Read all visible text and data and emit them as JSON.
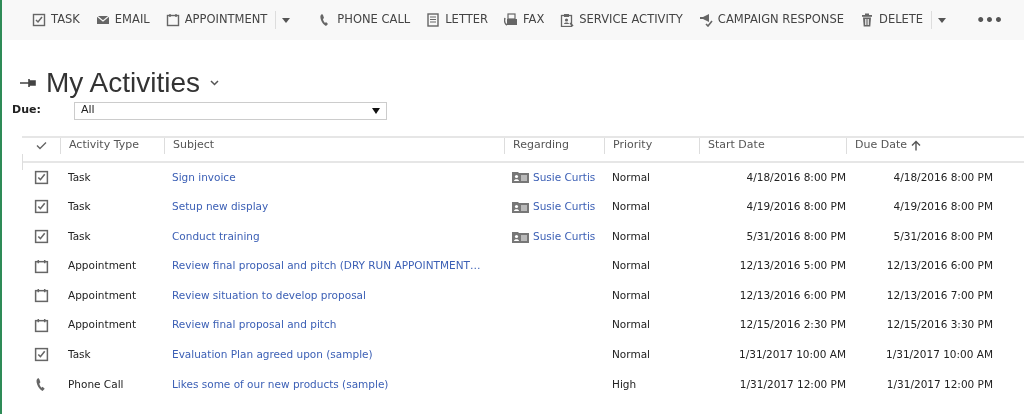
{
  "toolbar": {
    "items": [
      {
        "label": "TASK",
        "kind": "task",
        "split": false
      },
      {
        "label": "EMAIL",
        "kind": "email",
        "split": false
      },
      {
        "label": "APPOINTMENT",
        "kind": "appointment",
        "split": true
      },
      {
        "label": "PHONE CALL",
        "kind": "phone",
        "split": false
      },
      {
        "label": "LETTER",
        "kind": "letter",
        "split": false
      },
      {
        "label": "FAX",
        "kind": "fax",
        "split": false
      },
      {
        "label": "SERVICE ACTIVITY",
        "kind": "service",
        "split": false
      },
      {
        "label": "CAMPAIGN RESPONSE",
        "kind": "campaign",
        "split": false
      },
      {
        "label": "DELETE",
        "kind": "delete",
        "split": true
      }
    ],
    "more": "•••"
  },
  "view": {
    "title": "My Activities"
  },
  "filter": {
    "label": "Due:",
    "value": "All"
  },
  "table": {
    "columns": [
      {
        "label": "Activity Type",
        "sorted": false
      },
      {
        "label": "Subject",
        "sorted": false
      },
      {
        "label": "Regarding",
        "sorted": false
      },
      {
        "label": "Priority",
        "sorted": false
      },
      {
        "label": "Start Date",
        "sorted": false
      },
      {
        "label": "Due Date",
        "sorted": true
      }
    ],
    "rows": [
      {
        "kind": "task",
        "type": "Task",
        "subject": "Sign invoice",
        "regarding": "Susie Curtis",
        "priority": "Normal",
        "start": "4/18/2016 8:00 PM",
        "due": "4/18/2016 8:00 PM"
      },
      {
        "kind": "task",
        "type": "Task",
        "subject": "Setup new display",
        "regarding": "Susie Curtis",
        "priority": "Normal",
        "start": "4/19/2016 8:00 PM",
        "due": "4/19/2016 8:00 PM"
      },
      {
        "kind": "task",
        "type": "Task",
        "subject": "Conduct training",
        "regarding": "Susie Curtis",
        "priority": "Normal",
        "start": "5/31/2016 8:00 PM",
        "due": "5/31/2016 8:00 PM"
      },
      {
        "kind": "appointment",
        "type": "Appointment",
        "subject": "Review final proposal and pitch (DRY RUN APPOINTMENT…",
        "priority": "Normal",
        "start": "12/13/2016 5:00 PM",
        "due": "12/13/2016 6:00 PM"
      },
      {
        "kind": "appointment",
        "type": "Appointment",
        "subject": "Review situation to develop proposal",
        "priority": "Normal",
        "start": "12/13/2016 6:00 PM",
        "due": "12/13/2016 7:00 PM"
      },
      {
        "kind": "appointment",
        "type": "Appointment",
        "subject": "Review final proposal and pitch",
        "priority": "Normal",
        "start": "12/15/2016 2:30 PM",
        "due": "12/15/2016 3:30 PM"
      },
      {
        "kind": "task",
        "type": "Task",
        "subject": "Evaluation Plan agreed upon (sample)",
        "priority": "Normal",
        "start": "1/31/2017 10:00 AM",
        "due": "1/31/2017 10:00 AM"
      },
      {
        "kind": "phone",
        "type": "Phone Call",
        "subject": "Likes some of our new products (sample)",
        "priority": "High",
        "start": "1/31/2017 12:00 PM",
        "due": "1/31/2017 12:00 PM"
      }
    ]
  }
}
